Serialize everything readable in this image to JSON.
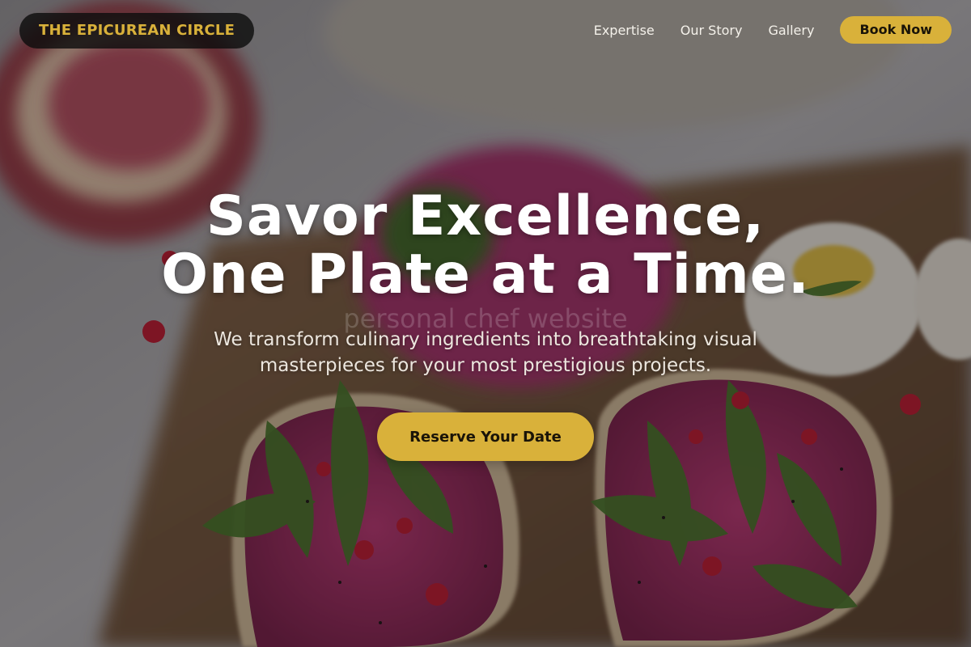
{
  "brand": {
    "name": "THE EPICUREAN CIRCLE"
  },
  "nav": {
    "links": [
      "Expertise",
      "Our Story",
      "Gallery"
    ],
    "cta_label": "Book Now"
  },
  "hero": {
    "title_line1": "Savor Excellence,",
    "title_line2": "One Plate at a Time.",
    "watermark": "personal chef website",
    "subtitle": "We transform culinary ingredients into breathtaking visual masterpieces for your most prestigious projects.",
    "cta_label": "Reserve Your Date",
    "background": "blurred food photo: beet hummus toasts with arugula and pomegranate on a wooden board, pomegranate half and eggs behind"
  },
  "colors": {
    "accent": "#d9b13a",
    "brand_pill": "#0e0e0e",
    "text_light": "#ffffff"
  }
}
